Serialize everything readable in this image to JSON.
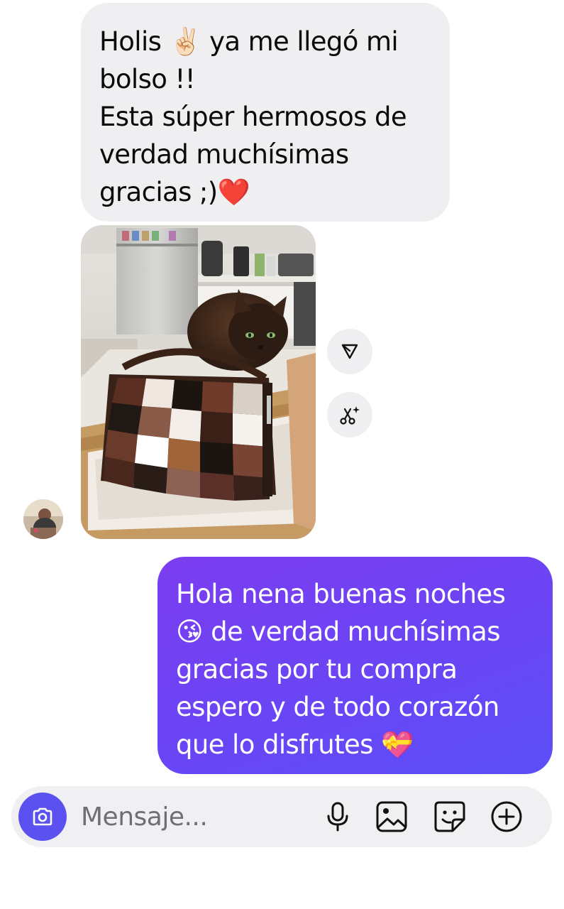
{
  "incoming_message": {
    "lines": [
      "Holis ✌🏻  ya me llegó mi",
      "bolso !!",
      "Esta súper hermosos de",
      "verdad muchísimas",
      "gracias ;)❤️"
    ]
  },
  "outgoing_message": {
    "lines": [
      "Hola nena buenas noches",
      "😘  de verdad muchísimas",
      "gracias por tu compra",
      "espero y de todo corazón",
      "que lo disfrutes 💝"
    ]
  },
  "photo_actions": [
    "share-icon",
    "scissors-sparkle-icon"
  ],
  "composer": {
    "placeholder": "Mensaje...",
    "icons": [
      "camera-icon",
      "microphone-icon",
      "image-icon",
      "sticker-icon",
      "plus-icon"
    ]
  },
  "colors": {
    "incoming_bubble": "#efeff2",
    "outgoing_bubble_start": "#7b3df0",
    "outgoing_bubble_end": "#5b4ff7",
    "camera_button": "#5a51f0",
    "composer_bg": "#f0f0f3"
  }
}
